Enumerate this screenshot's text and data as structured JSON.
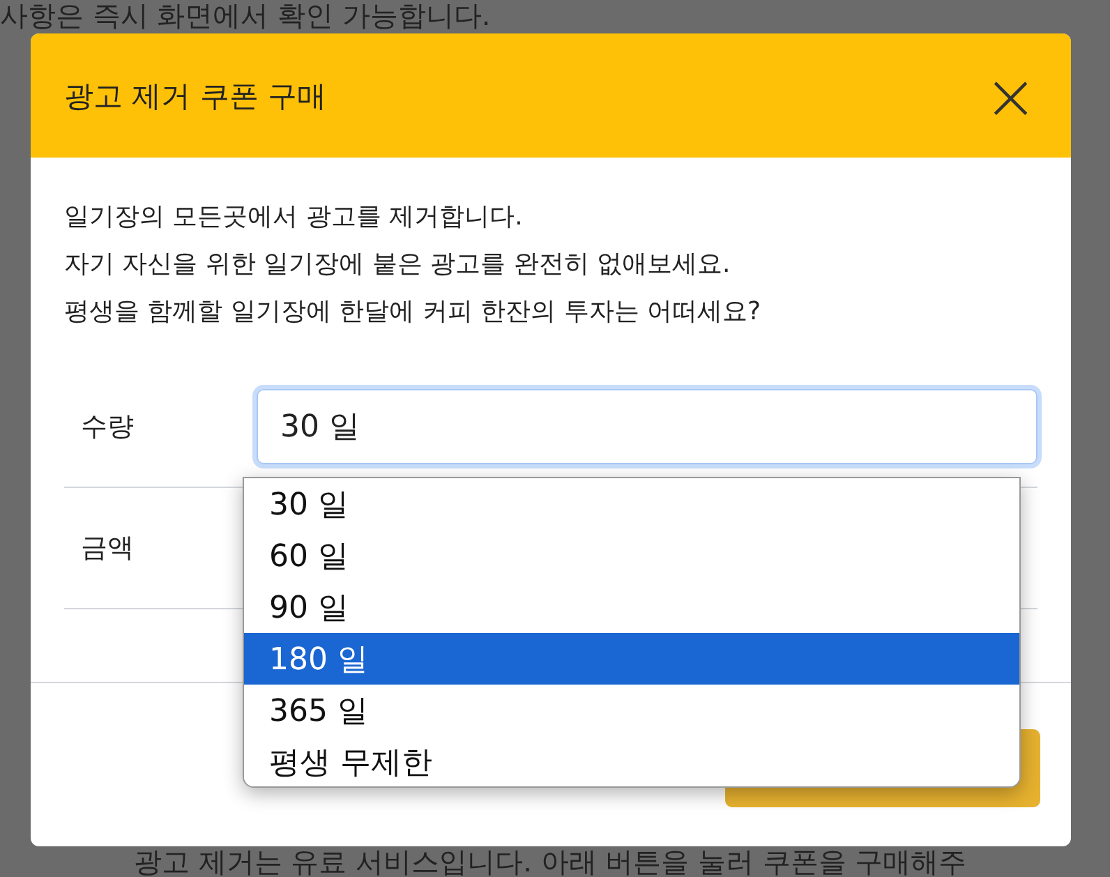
{
  "background": {
    "top_text": "사항은 즉시 화면에서 확인 가능합니다.",
    "bottom_text": "광고 제거는 유료 서비스입니다. 아래 버튼을 눌러 쿠폰을 구매해주"
  },
  "dialog": {
    "title": "광고 제거 쿠폰 구매",
    "close": "×",
    "description": [
      "일기장의 모든곳에서 광고를 제거합니다.",
      "자기 자신을 위한 일기장에 붙은 광고를 완전히 없애보세요.",
      "평생을 함께할 일기장에 한달에 커피 한잔의 투자는 어떠세요?"
    ],
    "quantity": {
      "label": "수량",
      "value": "30 일"
    },
    "amount": {
      "label": "금액"
    },
    "options": [
      {
        "label": "30 일",
        "selected": false
      },
      {
        "label": "60 일",
        "selected": false
      },
      {
        "label": "90 일",
        "selected": false
      },
      {
        "label": "180 일",
        "selected": true
      },
      {
        "label": "365 일",
        "selected": false
      },
      {
        "label": "평생 무제한",
        "selected": false
      }
    ]
  }
}
